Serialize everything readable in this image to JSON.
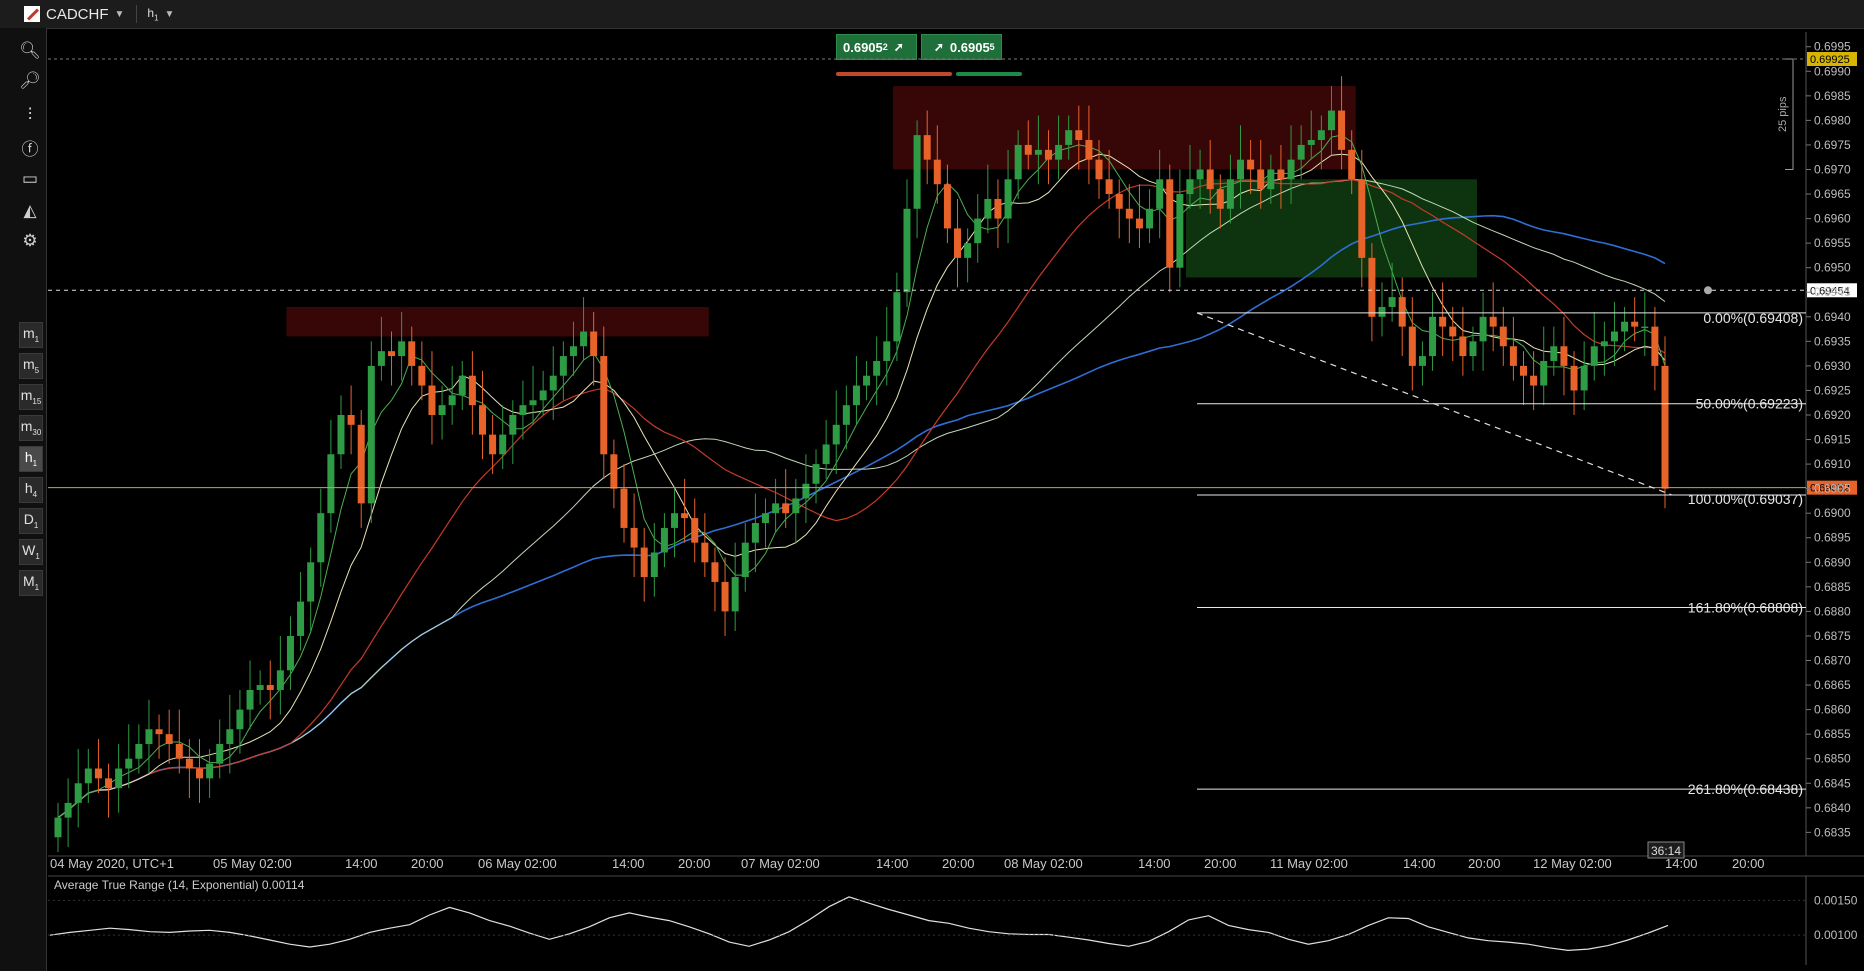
{
  "window": {
    "symbol": "CADCHF",
    "timeframe": "h",
    "timeframe_sub": "1"
  },
  "toolbar": {
    "tools": [
      "zoom-in-icon",
      "zoom-out-icon",
      "indicators-icon",
      "social-icon",
      "chart-type-icon",
      "drawing-icon",
      "settings-icon"
    ],
    "timeframes": [
      {
        "label": "m",
        "sub": "1"
      },
      {
        "label": "m",
        "sub": "5"
      },
      {
        "label": "m",
        "sub": "15"
      },
      {
        "label": "m",
        "sub": "30"
      },
      {
        "label": "h",
        "sub": "1"
      },
      {
        "label": "h",
        "sub": "4"
      },
      {
        "label": "D",
        "sub": "1"
      },
      {
        "label": "W",
        "sub": "1"
      },
      {
        "label": "M",
        "sub": "1"
      }
    ],
    "active_timeframe": "h1"
  },
  "trade": {
    "sell_price": "0.6905",
    "sell_pip": "2",
    "buy_price": "0.6905",
    "buy_pip": "5"
  },
  "chart_data": {
    "type": "candlestick",
    "symbol": "CADCHF",
    "ylim": [
      0.6831,
      0.6998
    ],
    "y_ticks": [
      0.6995,
      0.699,
      0.6985,
      0.698,
      0.6975,
      0.697,
      0.6965,
      0.696,
      0.6955,
      0.695,
      0.6945,
      0.694,
      0.6935,
      0.693,
      0.6925,
      0.692,
      0.6915,
      0.691,
      0.6905,
      0.69,
      0.6895,
      0.689,
      0.6885,
      0.688,
      0.6875,
      0.687,
      0.6865,
      0.686,
      0.6855,
      0.685,
      0.6845,
      0.684,
      0.6835
    ],
    "x_tick_labels": [
      "04 May 2020, UTC+1",
      "05 May 02:00",
      "14:00",
      "20:00",
      "06 May 02:00",
      "14:00",
      "20:00",
      "07 May 02:00",
      "14:00",
      "20:00",
      "08 May 02:00",
      "14:00",
      "20:00",
      "11 May 02:00",
      "14:00",
      "20:00",
      "12 May 02:00",
      "14:00",
      "20:00"
    ],
    "closes": [
      0.6838,
      0.6841,
      0.6845,
      0.6848,
      0.6846,
      0.6844,
      0.6848,
      0.685,
      0.6853,
      0.6856,
      0.6855,
      0.6853,
      0.685,
      0.6848,
      0.6846,
      0.6849,
      0.6853,
      0.6856,
      0.686,
      0.6864,
      0.6865,
      0.6864,
      0.6868,
      0.6875,
      0.6882,
      0.689,
      0.69,
      0.6912,
      0.692,
      0.6918,
      0.6902,
      0.693,
      0.6933,
      0.6932,
      0.6935,
      0.693,
      0.6926,
      0.692,
      0.6922,
      0.6924,
      0.6928,
      0.6922,
      0.6916,
      0.6912,
      0.6916,
      0.692,
      0.6922,
      0.6923,
      0.6925,
      0.6928,
      0.6932,
      0.6934,
      0.6937,
      0.6932,
      0.6912,
      0.6905,
      0.6897,
      0.6893,
      0.6887,
      0.6892,
      0.6897,
      0.69,
      0.6899,
      0.6894,
      0.689,
      0.6886,
      0.688,
      0.6887,
      0.6894,
      0.6898,
      0.69,
      0.6902,
      0.69,
      0.6903,
      0.6906,
      0.691,
      0.6914,
      0.6918,
      0.6922,
      0.6926,
      0.6928,
      0.6931,
      0.6935,
      0.6945,
      0.6962,
      0.6977,
      0.6972,
      0.6967,
      0.6958,
      0.6952,
      0.6955,
      0.696,
      0.6964,
      0.696,
      0.6968,
      0.6975,
      0.6973,
      0.6974,
      0.6972,
      0.6975,
      0.6978,
      0.6976,
      0.6972,
      0.6968,
      0.6965,
      0.6962,
      0.696,
      0.6958,
      0.6962,
      0.6968,
      0.695,
      0.6965,
      0.6968,
      0.697,
      0.6966,
      0.6962,
      0.6968,
      0.6972,
      0.697,
      0.6966,
      0.697,
      0.6968,
      0.6972,
      0.6975,
      0.6976,
      0.6978,
      0.6982,
      0.6974,
      0.6968,
      0.6952,
      0.694,
      0.6942,
      0.6944,
      0.6938,
      0.693,
      0.6932,
      0.694,
      0.6938,
      0.6936,
      0.6932,
      0.6935,
      0.694,
      0.6938,
      0.6934,
      0.693,
      0.6928,
      0.6926,
      0.6931,
      0.6934,
      0.693,
      0.6925,
      0.693,
      0.6934,
      0.6935,
      0.6937,
      0.6939,
      0.6938,
      0.6938,
      0.693,
      0.6905
    ],
    "overlays": [
      {
        "kind": "supply_zone",
        "from_bar": 23,
        "to_bar": 64,
        "y_top": 0.6942,
        "y_bottom": 0.6936,
        "color": "#3a0606"
      },
      {
        "kind": "supply_zone",
        "from_bar": 83,
        "to_bar": 128,
        "y_top": 0.6987,
        "y_bottom": 0.697,
        "color": "#3a0606"
      },
      {
        "kind": "demand_zone",
        "from_bar": 112,
        "to_bar": 140,
        "y_top": 0.6968,
        "y_bottom": 0.6948,
        "color": "#0f3d12"
      }
    ],
    "price_levels": [
      {
        "value": 0.69925,
        "label": "0.69925",
        "color": "#d6b400"
      },
      {
        "value": 0.69454,
        "label": "0.69454",
        "color": "#ffffff"
      },
      {
        "value": 0.69052,
        "label": "0.69052",
        "color": "#e8632a"
      }
    ],
    "fibonacci": [
      {
        "label": "0.00%(0.69408)",
        "value": 0.69408
      },
      {
        "label": "50.00%(0.69223)",
        "value": 0.69223
      },
      {
        "label": "100.00%(0.69037)",
        "value": 0.69037
      },
      {
        "label": "161.80%(0.68808)",
        "value": 0.68808
      },
      {
        "label": "261.80%(0.68438)",
        "value": 0.68438
      }
    ],
    "measure_label": "25 pips",
    "countdown": "36:14"
  },
  "atr_panel": {
    "title": "Average True Range (14, Exponential) 0.00114",
    "y_ticks": [
      "0.00150",
      "0.00100"
    ],
    "values": [
      0.001,
      0.00104,
      0.00107,
      0.0011,
      0.00108,
      0.00105,
      0.00104,
      0.00106,
      0.00107,
      0.00104,
      0.00099,
      0.00093,
      0.00087,
      0.00083,
      0.00087,
      0.00094,
      0.00104,
      0.0011,
      0.00115,
      0.00129,
      0.0014,
      0.00132,
      0.00121,
      0.00113,
      0.00103,
      0.00094,
      0.00102,
      0.00112,
      0.00125,
      0.00132,
      0.00126,
      0.00121,
      0.00112,
      0.00102,
      0.0009,
      0.00084,
      0.00093,
      0.00105,
      0.00122,
      0.00141,
      0.00155,
      0.00146,
      0.00137,
      0.00129,
      0.00121,
      0.00117,
      0.0011,
      0.00105,
      0.00102,
      0.00101,
      0.00101,
      0.00097,
      0.00093,
      0.00088,
      0.00084,
      0.00091,
      0.00105,
      0.00122,
      0.00128,
      0.00114,
      0.00108,
      0.00104,
      0.00094,
      0.00087,
      0.00092,
      0.00101,
      0.00114,
      0.00125,
      0.00124,
      0.00112,
      0.00104,
      0.00096,
      0.00092,
      0.0009,
      0.00087,
      0.00082,
      0.00078,
      0.0008,
      0.00085,
      0.00093,
      0.00103,
      0.00114
    ]
  }
}
